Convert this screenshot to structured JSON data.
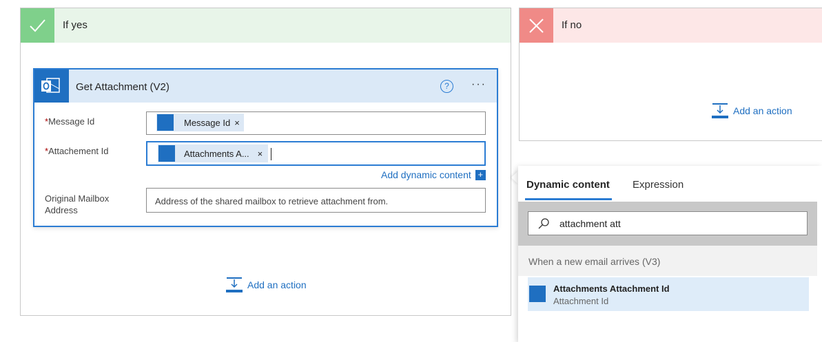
{
  "yes_branch": {
    "title": "If yes"
  },
  "no_branch": {
    "title": "If no",
    "add_action": "Add an action"
  },
  "card": {
    "title": "Get Attachment (V2)",
    "help_glyph": "?",
    "more_glyph": "···",
    "fields": {
      "message_id": {
        "required_mark": "*",
        "label": "Message Id",
        "token": "Message Id"
      },
      "attachment_id": {
        "required_mark": "*",
        "label": "Attachement Id",
        "token": "Attachments A..."
      },
      "mailbox": {
        "label_line1": "Original Mailbox",
        "label_line2": "Address",
        "placeholder": "Address of the shared mailbox to retrieve attachment from."
      }
    },
    "add_dynamic_content": "Add dynamic content"
  },
  "yes_add_action": "Add an action",
  "dynamic_panel": {
    "tabs": [
      "Dynamic content",
      "Expression"
    ],
    "search_value": "attachment att",
    "group_header": "When a new email arrives (V3)",
    "result": {
      "title": "Attachments Attachment Id",
      "subtitle": "Attachment Id"
    }
  },
  "colors": {
    "accent": "#2b7cd3",
    "yes_header": "#e8f5e9",
    "yes_badge": "#7fd08b",
    "no_header": "#fde7e7",
    "no_badge": "#f08a87",
    "outlook_blue": "#1f6fc1"
  },
  "icons": {
    "yes": "check-icon",
    "no": "close-icon",
    "card": "outlook-icon",
    "add_action": "add-action-icon",
    "search": "search-icon"
  }
}
